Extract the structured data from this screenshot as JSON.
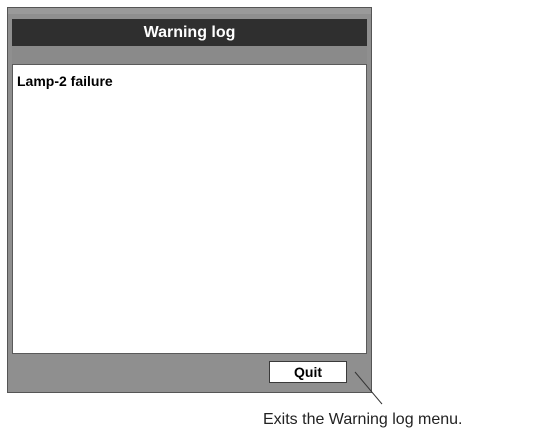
{
  "window": {
    "title": "Warning log",
    "log_entries": [
      "Lamp-2 failure"
    ],
    "quit_label": "Quit"
  },
  "annotation": {
    "text": "Exits the Warning log menu."
  },
  "colors": {
    "frame": "#8f8f8f",
    "titlebar": "#2f2f2f",
    "title_text": "#ffffff",
    "panel": "#ffffff"
  }
}
